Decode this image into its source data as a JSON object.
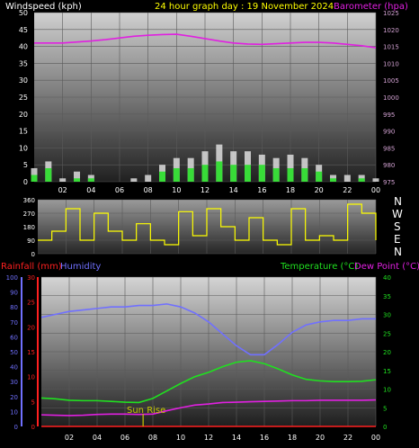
{
  "header": {
    "left_label": "Windspeed (kph)",
    "center_label": "24 hour graph day : 19 November 2024",
    "right_label": "Barometer (hpa)"
  },
  "middle": {
    "compass": [
      "N",
      "W",
      "S",
      "E",
      "N"
    ]
  },
  "bottom_header": {
    "rain_label": "Rainfall (mm)",
    "humidity_label": "Humidity",
    "temp_label": "Temperature (°C)",
    "dew_label": "Dew Point (°C)"
  },
  "sunrise_label": "Sun Rise",
  "colors": {
    "windspeed": "#ffffff",
    "gust": "#dddddd",
    "barometer": "#e020e0",
    "direction": "#ffff00",
    "rain": "#ff2020",
    "humidity": "#7070ff",
    "temperature": "#20e020",
    "dewpoint": "#e020e0",
    "sunrise": "#c8c800"
  },
  "chart_data": [
    {
      "type": "line",
      "title": "24 hour graph day : 19 November 2024",
      "x_hours": [
        0,
        1,
        2,
        3,
        4,
        5,
        6,
        7,
        8,
        9,
        10,
        11,
        12,
        13,
        14,
        15,
        16,
        17,
        18,
        19,
        20,
        21,
        22,
        23,
        24
      ],
      "x_ticks": [
        "02",
        "04",
        "06",
        "08",
        "10",
        "12",
        "14",
        "16",
        "18",
        "20",
        "22",
        "00"
      ],
      "y_left_label": "Windspeed (kph)",
      "y_left_lim": [
        0,
        50
      ],
      "y_left_ticks": [
        0,
        5,
        10,
        15,
        20,
        25,
        30,
        35,
        40,
        45,
        50
      ],
      "y_right_label": "Barometer (hpa)",
      "y_right_lim": [
        975,
        1025
      ],
      "y_right_ticks": [
        975,
        980,
        985,
        990,
        995,
        1000,
        1005,
        1010,
        1015,
        1020,
        1025
      ],
      "series": [
        {
          "name": "Barometer (hpa)",
          "axis": "right",
          "values": [
            1016,
            1016,
            1016,
            1016.3,
            1016.6,
            1017,
            1017.5,
            1018,
            1018.3,
            1018.5,
            1018.6,
            1018,
            1017.3,
            1016.6,
            1016,
            1015.7,
            1015.6,
            1015.8,
            1016,
            1016.2,
            1016.2,
            1016,
            1015.6,
            1015.2,
            1014.6
          ]
        },
        {
          "name": "Windspeed (kph)",
          "axis": "left",
          "values": [
            2,
            4,
            0,
            1,
            1,
            0,
            0,
            0,
            0,
            3,
            4,
            4,
            5,
            6,
            5,
            5,
            5,
            4,
            4,
            4,
            3,
            1,
            0,
            1,
            0
          ]
        },
        {
          "name": "Gust (kph)",
          "axis": "left",
          "values": [
            4,
            6,
            1,
            3,
            2,
            0,
            0,
            1,
            2,
            5,
            7,
            7,
            9,
            11,
            9,
            9,
            8,
            7,
            8,
            7,
            5,
            2,
            2,
            2,
            1
          ]
        }
      ]
    },
    {
      "type": "line",
      "x_hours": [
        0,
        1,
        2,
        3,
        4,
        5,
        6,
        7,
        8,
        9,
        10,
        11,
        12,
        13,
        14,
        15,
        16,
        17,
        18,
        19,
        20,
        21,
        22,
        23,
        24
      ],
      "y_lim": [
        0,
        360
      ],
      "y_ticks": [
        0,
        90,
        180,
        270,
        360
      ],
      "series": [
        {
          "name": "Wind Direction",
          "values": [
            90,
            150,
            300,
            90,
            270,
            150,
            90,
            200,
            90,
            60,
            280,
            120,
            300,
            180,
            90,
            240,
            90,
            60,
            300,
            90,
            120,
            90,
            330,
            270,
            90
          ]
        }
      ]
    },
    {
      "type": "line",
      "x_hours": [
        0,
        1,
        2,
        3,
        4,
        5,
        6,
        7,
        8,
        9,
        10,
        11,
        12,
        13,
        14,
        15,
        16,
        17,
        18,
        19,
        20,
        21,
        22,
        23,
        24
      ],
      "y_left_outer_label": "Humidity",
      "y_left_outer_lim": [
        0,
        100
      ],
      "y_left_outer_ticks": [
        0,
        10,
        20,
        30,
        40,
        50,
        60,
        70,
        80,
        90,
        100
      ],
      "y_left_inner_label": "Rainfall (mm)",
      "y_left_inner_lim": [
        0,
        30
      ],
      "y_left_inner_ticks": [
        0,
        5,
        10,
        15,
        20,
        25,
        30
      ],
      "y_right_label": "Temperature (°C)",
      "y_right_lim": [
        0,
        40
      ],
      "y_right_ticks": [
        0,
        5,
        10,
        15,
        20,
        25,
        30,
        35,
        40
      ],
      "sunrise_hour": 7.3,
      "series": [
        {
          "name": "Humidity",
          "axis": "humidity",
          "values": [
            73,
            75,
            77,
            78,
            79,
            80,
            80,
            81,
            81,
            82,
            80,
            76,
            70,
            62,
            54,
            48,
            48,
            55,
            63,
            68,
            70,
            71,
            71,
            72,
            72
          ]
        },
        {
          "name": "Temperature (°C)",
          "axis": "temp",
          "values": [
            7.6,
            7.4,
            7.0,
            6.9,
            6.9,
            6.7,
            6.5,
            6.4,
            7.5,
            9.5,
            11.5,
            13.3,
            14.5,
            16.0,
            17.2,
            17.6,
            16.8,
            15.4,
            13.8,
            12.6,
            12.2,
            12.0,
            12.0,
            12.1,
            12.5
          ]
        },
        {
          "name": "Dew Point (°C)",
          "axis": "temp",
          "values": [
            3.1,
            3.0,
            2.9,
            3.0,
            3.2,
            3.3,
            3.3,
            3.2,
            3.3,
            4.2,
            5.0,
            5.7,
            6.0,
            6.4,
            6.5,
            6.6,
            6.7,
            6.8,
            6.9,
            6.9,
            7.0,
            7.0,
            7.0,
            7.0,
            7.1
          ]
        },
        {
          "name": "Rainfall (mm)",
          "axis": "rain",
          "values": [
            0,
            0,
            0,
            0,
            0,
            0,
            0,
            0,
            0,
            0,
            0,
            0,
            0,
            0,
            0,
            0,
            0,
            0,
            0,
            0,
            0,
            0,
            0,
            0,
            0
          ]
        }
      ]
    }
  ]
}
